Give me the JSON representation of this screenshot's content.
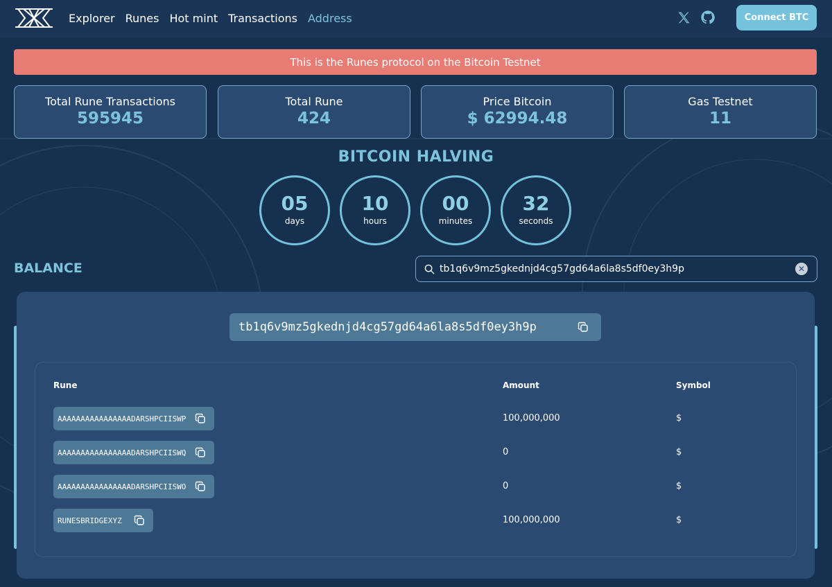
{
  "nav": {
    "links": [
      "Explorer",
      "Runes",
      "Hot mint",
      "Transactions",
      "Address"
    ],
    "active": "Address",
    "connect_label": "Connect BTC"
  },
  "banner": {
    "text": "This is the Runes protocol on the Bitcoin Testnet"
  },
  "stats": [
    {
      "label": "Total Rune Transactions",
      "value": "595945"
    },
    {
      "label": "Total Rune",
      "value": "424"
    },
    {
      "label": "Price Bitcoin",
      "value": "$ 62994.48"
    },
    {
      "label": "Gas Testnet",
      "value": "11"
    }
  ],
  "halving": {
    "title": "BITCOIN HALVING",
    "countdown": [
      {
        "value": "05",
        "unit": "days"
      },
      {
        "value": "10",
        "unit": "hours"
      },
      {
        "value": "00",
        "unit": "minutes"
      },
      {
        "value": "32",
        "unit": "seconds"
      }
    ]
  },
  "balance": {
    "title": "BALANCE",
    "search_value": "tb1q6v9mz5gkednjd4cg57gd64a6la8s5df0ey3h9p",
    "address": "tb1q6v9mz5gkednjd4cg57gd64a6la8s5df0ey3h9p",
    "table": {
      "headers": {
        "rune": "Rune",
        "amount": "Amount",
        "symbol": "Symbol"
      },
      "rows": [
        {
          "rune": "AAAAAAAAAAAAAAAADARSHPCIISWP",
          "amount": "100,000,000",
          "symbol": "$"
        },
        {
          "rune": "AAAAAAAAAAAAAAAADARSHPCIISWQ",
          "amount": "0",
          "symbol": "$"
        },
        {
          "rune": "AAAAAAAAAAAAAAAADARSHPCIISWO",
          "amount": "0",
          "symbol": "$"
        },
        {
          "rune": "RUNESBRIDGEXYZ",
          "amount": "100,000,000",
          "symbol": "$"
        }
      ]
    }
  },
  "colors": {
    "background": "#16304f",
    "accent": "#74c2dc",
    "panel": "#2a4a72",
    "banner": "#e87b74"
  }
}
